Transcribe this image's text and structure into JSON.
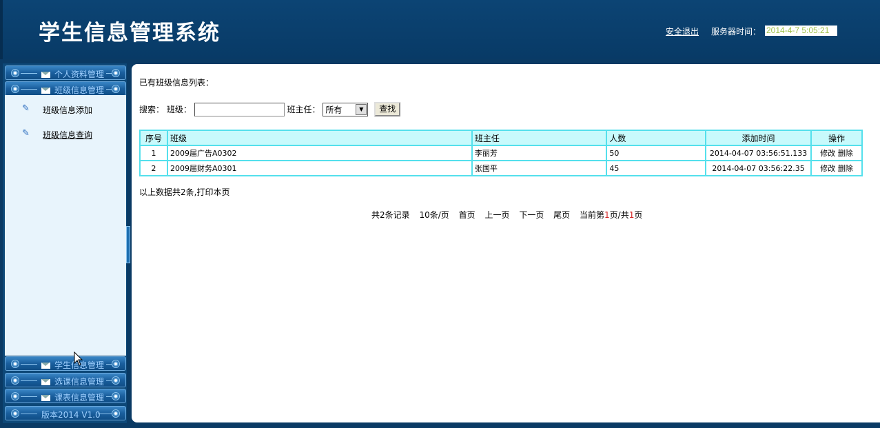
{
  "header": {
    "title": "学生信息管理系统",
    "logout": "安全退出",
    "server_time_label": "服务器时间：",
    "server_time": "2014-4-7 5:05:21"
  },
  "sidebar": {
    "top_menus": [
      "个人资料管理",
      "班级信息管理"
    ],
    "sub_items": [
      "班级信息添加",
      "班级信息查询"
    ],
    "bottom_menus": [
      "学生信息管理",
      "选课信息管理",
      "课表信息管理"
    ],
    "version": "版本2014 V1.0"
  },
  "main": {
    "caption": "已有班级信息列表：",
    "search": {
      "label": "搜索：",
      "class_label": "班级：",
      "class_value": "",
      "teacher_label": "班主任：",
      "teacher_selected": "所有",
      "button": "查找"
    },
    "table": {
      "headers": [
        "序号",
        "班级",
        "班主任",
        "人数",
        "添加时间",
        "操作"
      ],
      "rows": [
        {
          "no": "1",
          "class": "2009届广告A0302",
          "teacher": "李丽芳",
          "count": "50",
          "time": "2014-04-07 03:56:51.133",
          "edit": "修改",
          "delete": "删除"
        },
        {
          "no": "2",
          "class": "2009届财务A0301",
          "teacher": "张国平",
          "count": "45",
          "time": "2014-04-07 03:56:22.35",
          "edit": "修改",
          "delete": "删除"
        }
      ]
    },
    "summary": "以上数据共2条,打印本页",
    "pager": {
      "total": "共2条记录",
      "per_page": "10条/页",
      "first": "首页",
      "prev": "上一页",
      "next": "下一页",
      "last": "尾页",
      "current_prefix": "当前第",
      "current": "1",
      "current_mid": "页/共",
      "total_pages": "1",
      "current_suffix": "页"
    }
  }
}
